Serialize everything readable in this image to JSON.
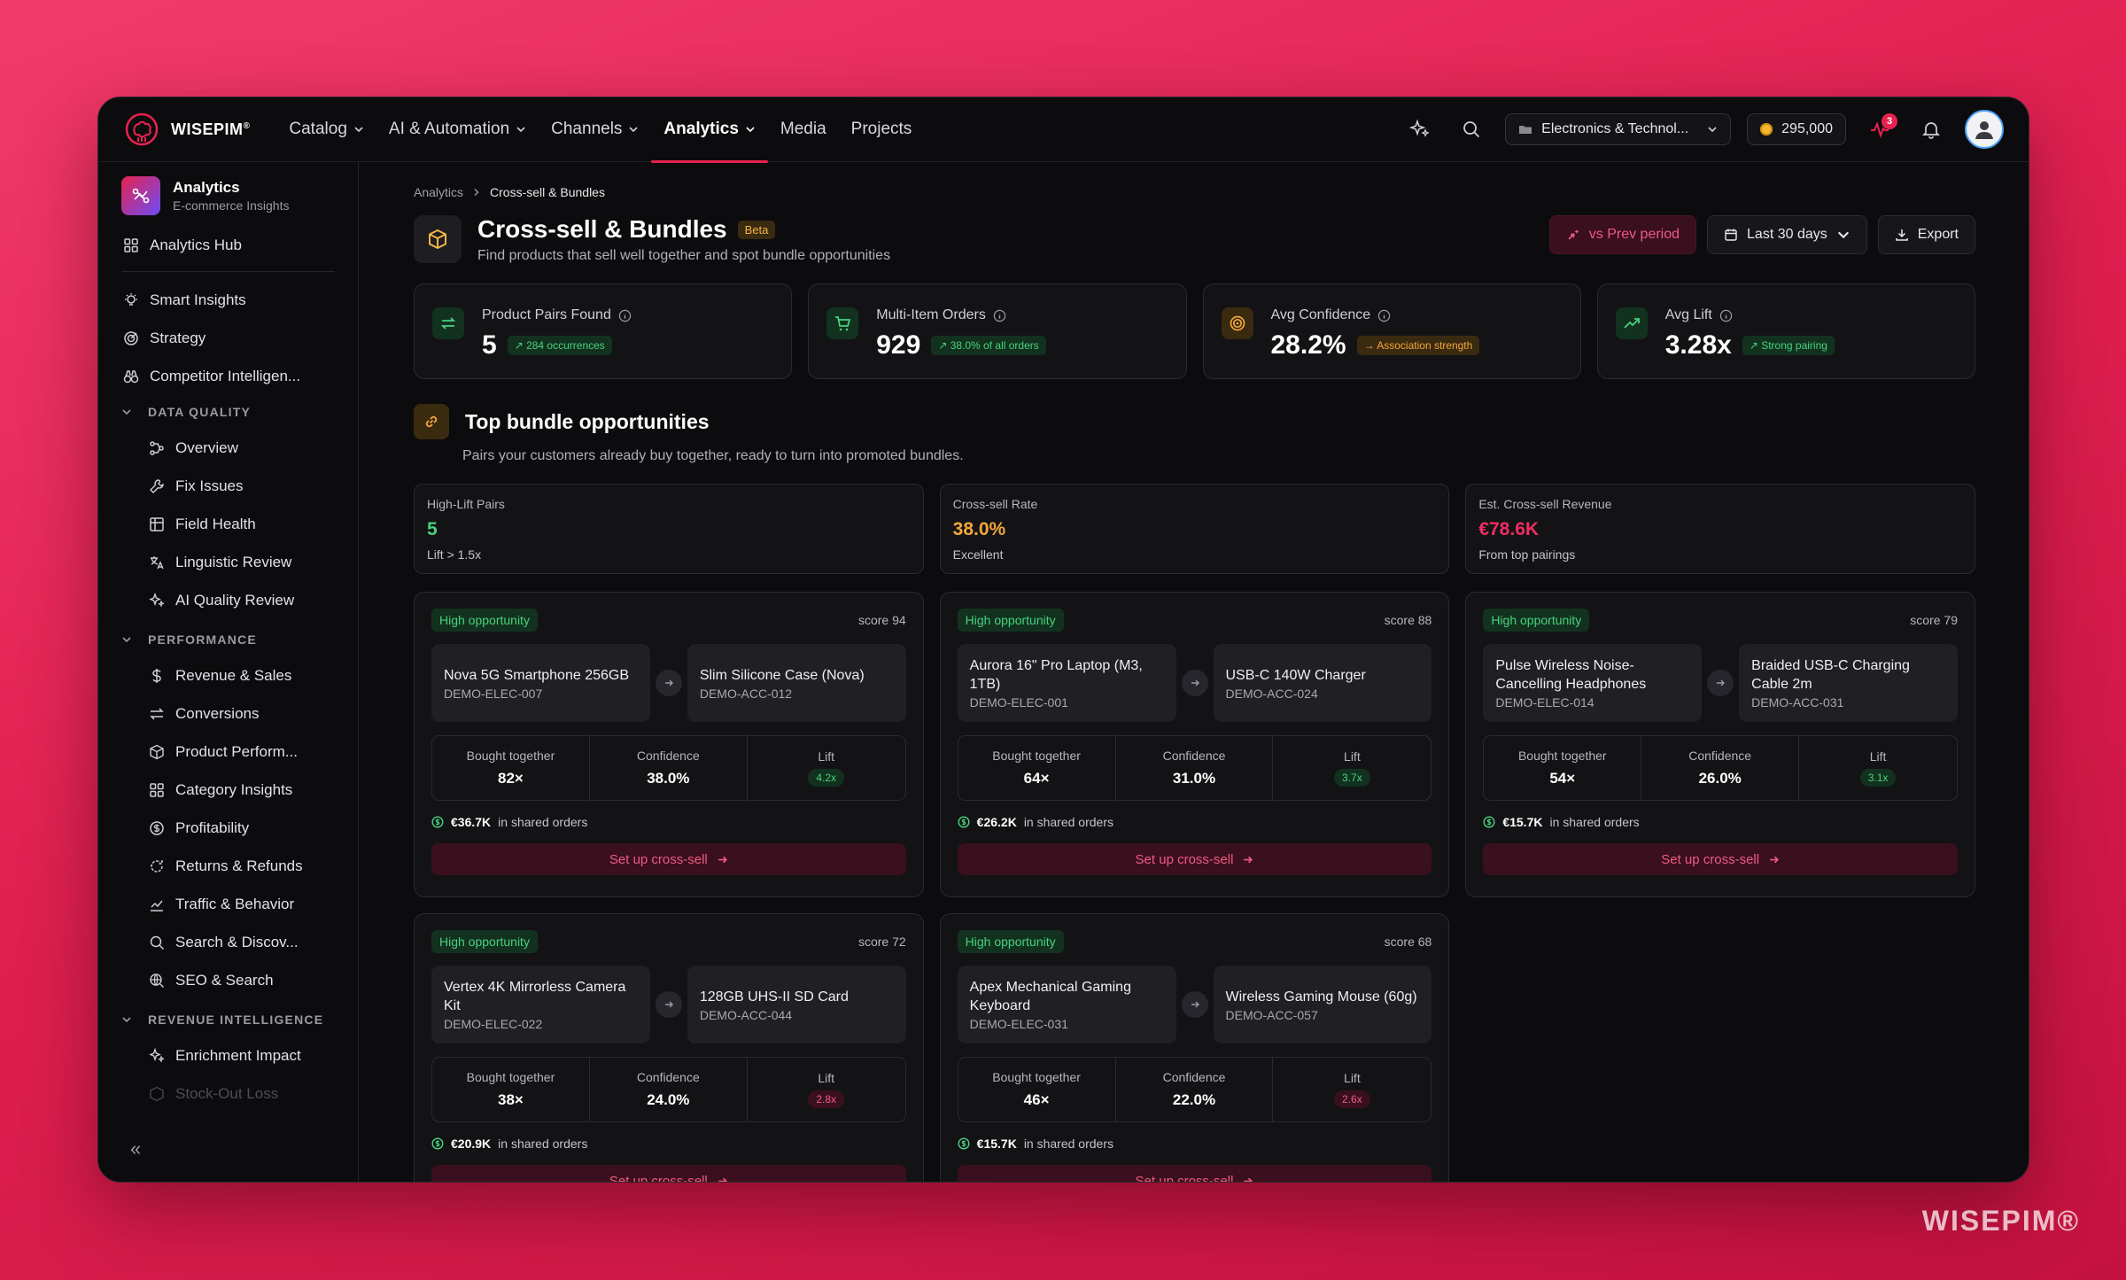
{
  "nav": {
    "brand": "WISEPIM",
    "brand_mark": "®",
    "items": [
      "Catalog",
      "AI & Automation",
      "Channels",
      "Analytics",
      "Media",
      "Projects"
    ],
    "workspace": "Electronics & Technol...",
    "credits": "295,000",
    "notif_count": "3"
  },
  "sidebar": {
    "title": "Analytics",
    "subtitle": "E-commerce Insights",
    "hub": "Analytics Hub",
    "top": [
      "Smart Insights",
      "Strategy",
      "Competitor Intelligen..."
    ],
    "sections": [
      {
        "label": "DATA QUALITY",
        "items": [
          "Overview",
          "Fix Issues",
          "Field Health",
          "Linguistic Review",
          "AI Quality Review"
        ]
      },
      {
        "label": "PERFORMANCE",
        "items": [
          "Revenue & Sales",
          "Conversions",
          "Product Perform...",
          "Category Insights",
          "Profitability",
          "Returns & Refunds",
          "Traffic & Behavior",
          "Search & Discov...",
          "SEO & Search"
        ]
      },
      {
        "label": "REVENUE INTELLIGENCE",
        "items": [
          "Enrichment Impact",
          "Stock-Out Loss"
        ]
      }
    ],
    "collapse": "«"
  },
  "page": {
    "crumb_parent": "Analytics",
    "crumb_current": "Cross-sell & Bundles",
    "title": "Cross-sell & Bundles",
    "beta": "Beta",
    "subtitle": "Find products that sell well together and spot bundle opportunities",
    "btn_compare": "vs Prev period",
    "btn_range": "Last 30 days",
    "btn_export": "Export"
  },
  "kpis": [
    {
      "label": "Product Pairs Found",
      "value": "5",
      "chip": "↗ 284 occurrences",
      "tone": "green"
    },
    {
      "label": "Multi-Item Orders",
      "value": "929",
      "chip": "↗ 38.0% of all orders",
      "tone": "green"
    },
    {
      "label": "Avg Confidence",
      "value": "28.2%",
      "chip": "→ Association strength",
      "tone": "amber"
    },
    {
      "label": "Avg Lift",
      "value": "3.28x",
      "chip": "↗ Strong pairing",
      "tone": "green"
    }
  ],
  "section": {
    "title": "Top bundle opportunities",
    "subtitle": "Pairs your customers already buy together, ready to turn into promoted bundles."
  },
  "stats": [
    {
      "label": "High-Lift Pairs",
      "value": "5",
      "foot": "Lift > 1.5x",
      "color": "#49d17d"
    },
    {
      "label": "Cross-sell Rate",
      "value": "38.0%",
      "foot": "Excellent",
      "color": "#f3a73a"
    },
    {
      "label": "Est. Cross-sell Revenue",
      "value": "€78.6K",
      "foot": "From top pairings",
      "color": "#ef2d63"
    }
  ],
  "card_labels": {
    "badge": "High opportunity",
    "bought": "Bought together",
    "confidence": "Confidence",
    "lift": "Lift",
    "shared_suffix": "in shared orders",
    "cta": "Set up cross-sell"
  },
  "bundles": [
    {
      "score": "score 94",
      "a_name": "Nova 5G Smartphone 256GB",
      "a_sku": "DEMO-ELEC-007",
      "b_name": "Slim Silicone Case (Nova)",
      "b_sku": "DEMO-ACC-012",
      "bought": "82×",
      "confidence": "38.0%",
      "lift": "4.2x",
      "lift_tone": "green",
      "shared": "€36.7K"
    },
    {
      "score": "score 88",
      "a_name": "Aurora 16\" Pro Laptop (M3, 1TB)",
      "a_sku": "DEMO-ELEC-001",
      "b_name": "USB-C 140W Charger",
      "b_sku": "DEMO-ACC-024",
      "bought": "64×",
      "confidence": "31.0%",
      "lift": "3.7x",
      "lift_tone": "green",
      "shared": "€26.2K"
    },
    {
      "score": "score 79",
      "a_name": "Pulse Wireless Noise-Cancelling Headphones",
      "a_sku": "DEMO-ELEC-014",
      "b_name": "Braided USB-C Charging Cable 2m",
      "b_sku": "DEMO-ACC-031",
      "bought": "54×",
      "confidence": "26.0%",
      "lift": "3.1x",
      "lift_tone": "green",
      "shared": "€15.7K"
    },
    {
      "score": "score 72",
      "a_name": "Vertex 4K Mirrorless Camera Kit",
      "a_sku": "DEMO-ELEC-022",
      "b_name": "128GB UHS-II SD Card",
      "b_sku": "DEMO-ACC-044",
      "bought": "38×",
      "confidence": "24.0%",
      "lift": "2.8x",
      "lift_tone": "pink",
      "shared": "€20.9K"
    },
    {
      "score": "score 68",
      "a_name": "Apex Mechanical Gaming Keyboard",
      "a_sku": "DEMO-ELEC-031",
      "b_name": "Wireless Gaming Mouse (60g)",
      "b_sku": "DEMO-ACC-057",
      "bought": "46×",
      "confidence": "22.0%",
      "lift": "2.6x",
      "lift_tone": "pink",
      "shared": "€15.7K"
    }
  ],
  "watermark": "WISEPIM®"
}
